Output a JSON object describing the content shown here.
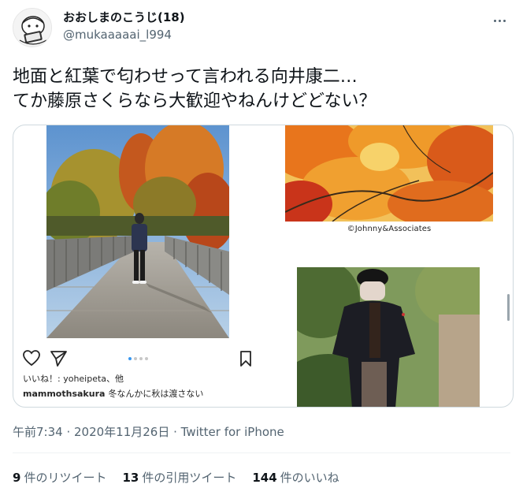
{
  "author": {
    "display_name": "おおしまのこうじ(18)",
    "handle": "@mukaaaaai_l994",
    "avatar_icon": "avatar-illustration-icon"
  },
  "header": {
    "more_icon": "more-horizontal-icon"
  },
  "tweet": {
    "text": "地面と紅葉で匂わせって言われる向井康二…\nてか藤原さくらなら大歓迎やねんけどどない？"
  },
  "media": {
    "instagram_card": {
      "icons": [
        "heart-icon",
        "send-icon",
        "carousel-dots-icon",
        "bookmark-icon"
      ],
      "likes_text": "いいね！: yoheipeta、他",
      "caption_user": "mammothsakura",
      "caption_text": "冬なんかに秋は渡さない"
    },
    "copyright_text": "©Johnny&Associates",
    "colors": {
      "autumn_orange": "#e8751c",
      "autumn_red": "#c9341a",
      "sky_blue": "#8fb7dc",
      "bridge_gray": "#7d7d7a"
    }
  },
  "meta": {
    "time": "午前7:34",
    "date": "2020年11月26日",
    "source": "Twitter for iPhone"
  },
  "stats": {
    "retweets_count": "9",
    "retweets_label": "件のリツイート",
    "quotes_count": "13",
    "quotes_label": "件の引用ツイート",
    "likes_count": "144",
    "likes_label": "件のいいね"
  }
}
